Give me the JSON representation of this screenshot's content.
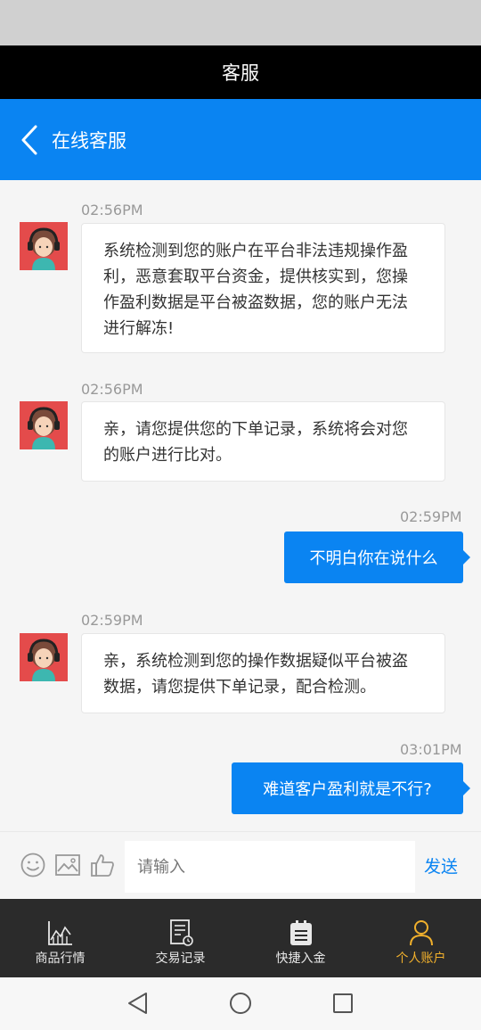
{
  "window": {
    "title": "客服"
  },
  "header": {
    "title": "在线客服"
  },
  "messages": [
    {
      "side": "in",
      "time": "02:56PM",
      "text": "系统检测到您的账户在平台非法违规操作盈利，恶意套取平台资金，提供核实到，您操作盈利数据是平台被盗数据，您的账户无法进行解冻!"
    },
    {
      "side": "in",
      "time": "02:56PM",
      "text": "亲，请您提供您的下单记录，系统将会对您的账户进行比对。"
    },
    {
      "side": "out",
      "time": "02:59PM",
      "text": "不明白你在说什么"
    },
    {
      "side": "in",
      "time": "02:59PM",
      "text": "亲，系统检测到您的操作数据疑似平台被盗数据，请您提供下单记录，配合检测。"
    },
    {
      "side": "out",
      "time": "03:01PM",
      "text": "难道客户盈利就是不行?"
    }
  ],
  "input": {
    "placeholder": "请输入",
    "send_label": "发送"
  },
  "tabs": [
    {
      "label": "商品行情",
      "icon": "chart-icon"
    },
    {
      "label": "交易记录",
      "icon": "receipt-icon"
    },
    {
      "label": "快捷入金",
      "icon": "clipboard-icon"
    },
    {
      "label": "个人账户",
      "icon": "person-icon",
      "active": true
    }
  ],
  "colors": {
    "accent": "#0a84f2",
    "active_tab": "#f1b02c",
    "avatar_bg": "#e44b4b"
  }
}
